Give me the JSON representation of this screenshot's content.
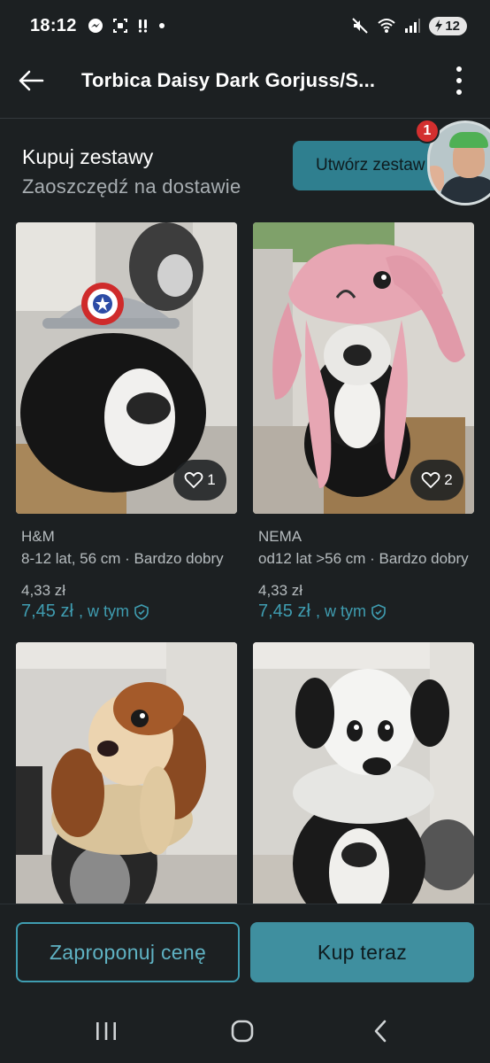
{
  "status": {
    "time": "18:12",
    "battery": "12"
  },
  "header": {
    "title": "Torbica Daisy Dark Gorjuss/S..."
  },
  "bundle": {
    "title": "Kupuj zestawy",
    "subtitle": "Zaoszczędź na dostawie",
    "button_label": "Utwórz zestaw"
  },
  "chat_head": {
    "badge": "1"
  },
  "items": [
    {
      "brand": "H&M",
      "details": "8-12 lat, 56 cm · Bardzo dobry",
      "price": "4,33 zł",
      "total": "7,45 zł",
      "incl": ", w tym",
      "likes": "1"
    },
    {
      "brand": "NEMA",
      "details": "od12 lat >56 cm · Bardzo dobry",
      "price": "4,33 zł",
      "total": "7,45 zł",
      "incl": ", w tym",
      "likes": "2"
    },
    {
      "brand": "",
      "details": "",
      "price": "",
      "total": "",
      "incl": "",
      "likes": ""
    },
    {
      "brand": "",
      "details": "",
      "price": "",
      "total": "",
      "incl": "",
      "likes": ""
    }
  ],
  "actions": {
    "offer_label": "Zaproponuj cenę",
    "buy_label": "Kup teraz"
  },
  "colors": {
    "background": "#1c2022",
    "accent": "#3f9db1",
    "button": "#3f8f9f",
    "badge": "#d32f2f"
  }
}
